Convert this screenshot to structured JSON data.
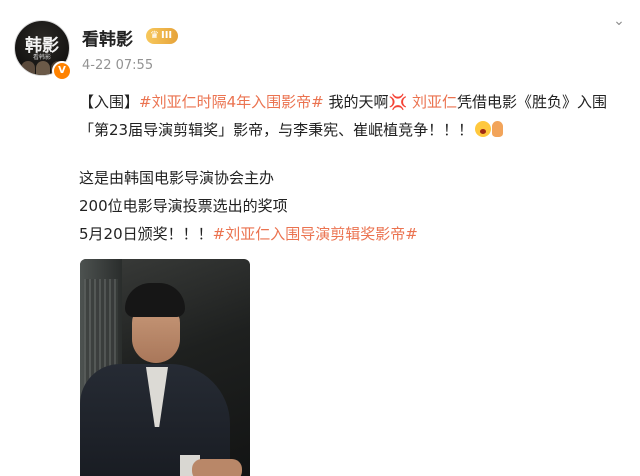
{
  "header": {
    "avatar_text": "韩影",
    "avatar_sub": "看韩影",
    "username": "看韩影",
    "level_badge": "III",
    "timestamp": "4-22 07:55",
    "verified_icon": "verified-v-icon",
    "more_icon": "chevron-down-icon"
  },
  "post": {
    "line1": {
      "bracket": "【入围】",
      "tag1": "#刘亚仁时隔4年入围影帝#",
      "text1": " 我的天啊",
      "emoji1": "💢",
      "mention": " 刘亚仁",
      "text2": "凭借电影《胜负》入围"
    },
    "line2": {
      "text": "「第23届导演剪辑奖」影帝，与李秉宪、崔岷植竞争！！！"
    },
    "line3": {
      "text": "这是由韩国电影导演协会主办"
    },
    "line4": {
      "text": "200位电影导演投票选出的奖项"
    },
    "line5": {
      "text": "5月20日颁奖！！！",
      "tag": "#刘亚仁入围导演剪辑奖影帝#"
    }
  },
  "colors": {
    "tag": "#eb7350",
    "username": "#222222",
    "timestamp": "#939393",
    "badge": "#f7c85c",
    "verified": "#ff8200"
  }
}
